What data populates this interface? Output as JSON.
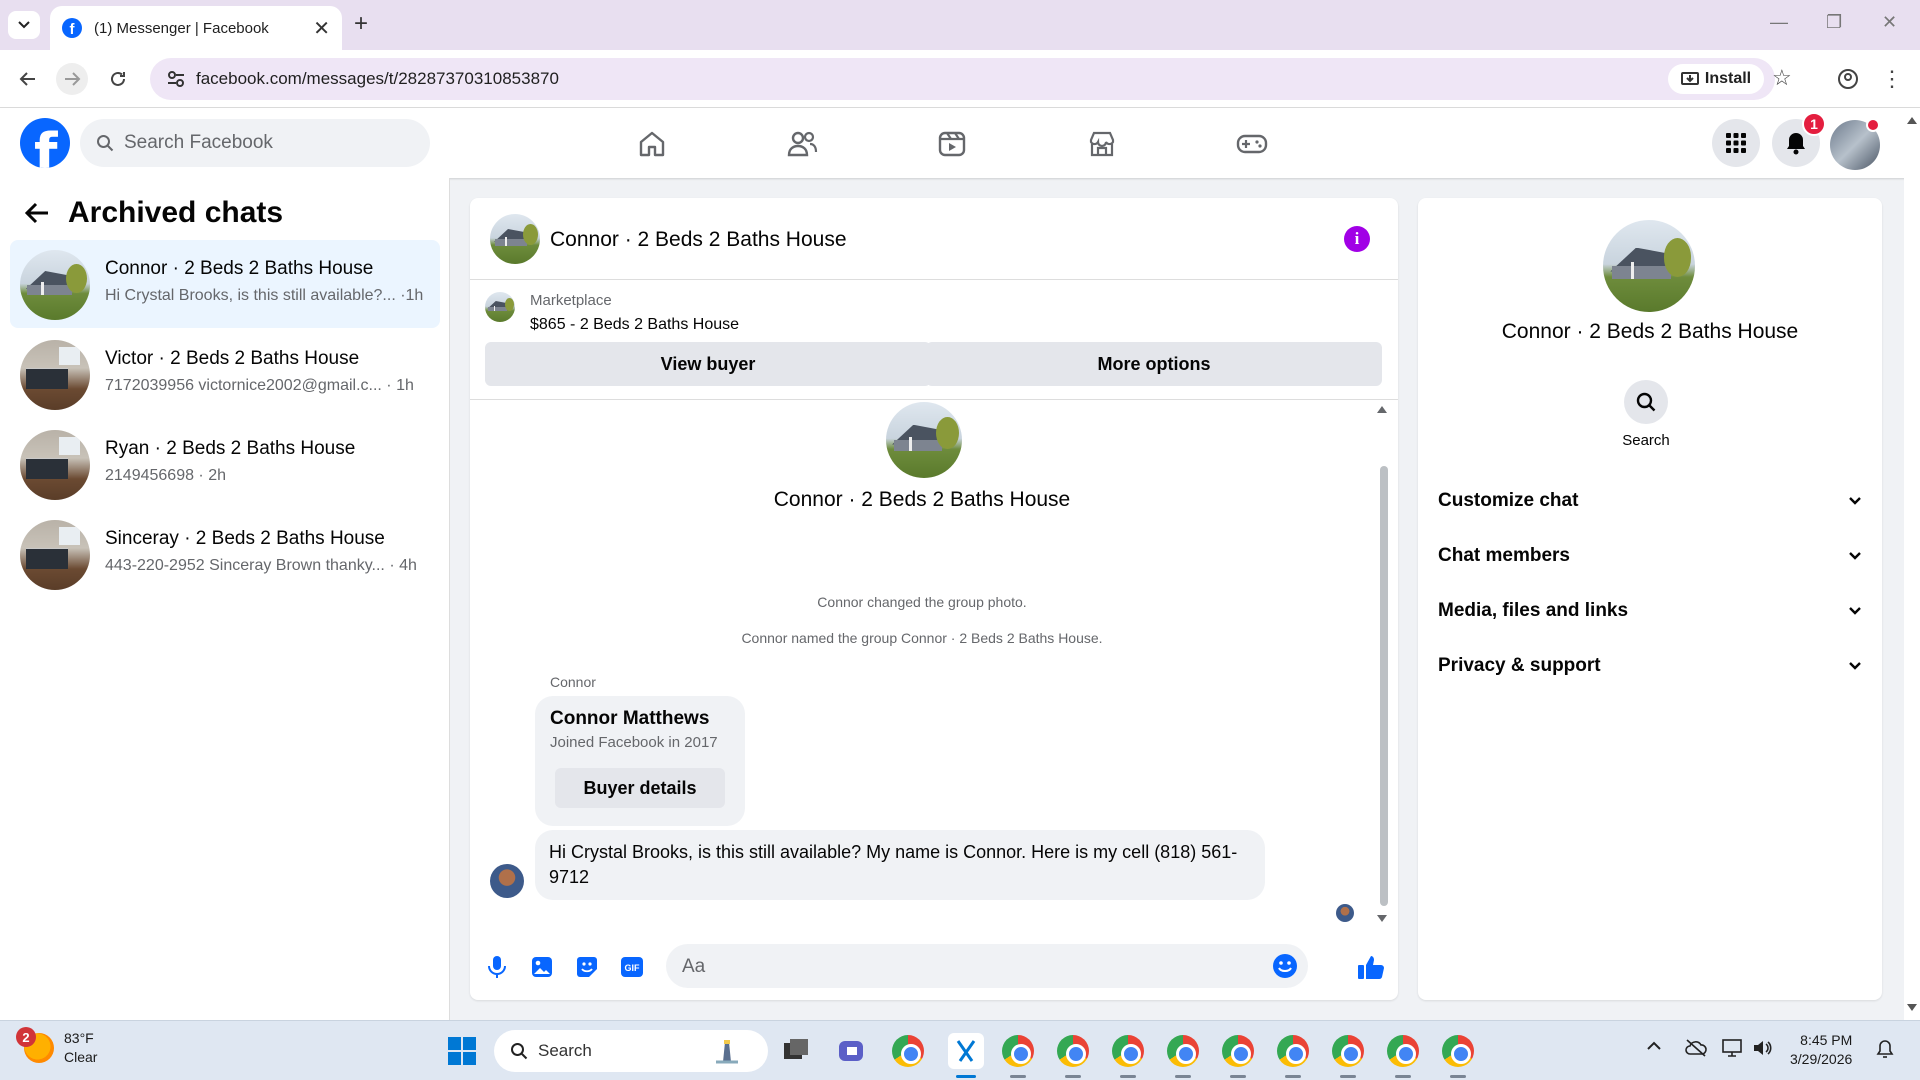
{
  "browser": {
    "tab_title": "(1) Messenger | Facebook",
    "url": "facebook.com/messages/t/28287370310853870",
    "install_label": "Install"
  },
  "fb_header": {
    "search_placeholder": "Search Facebook",
    "notification_count": "1",
    "nav_icons": [
      "home-icon",
      "friends-icon",
      "video-icon",
      "marketplace-icon",
      "gaming-icon"
    ]
  },
  "left_pane": {
    "title": "Archived chats",
    "chats": [
      {
        "name": "Connor · 2 Beds 2 Baths House",
        "snippet": "Hi Crystal Brooks, is this still available?... ·1h"
      },
      {
        "name": "Victor · 2 Beds 2 Baths House",
        "snippet": "7172039956 victornice2002@gmail.c... · 1h"
      },
      {
        "name": "Ryan · 2 Beds 2 Baths House",
        "snippet": "2149456698 · 2h"
      },
      {
        "name": "Sinceray · 2 Beds 2 Baths House",
        "snippet": "443-220-2952 Sinceray Brown thanky... · 4h"
      }
    ]
  },
  "chat": {
    "header_name": "Connor · 2 Beds 2 Baths House",
    "marketplace_label": "Marketplace",
    "listing": "$865 - 2 Beds 2 Baths House",
    "view_buyer": "View buyer",
    "more_options": "More options",
    "convo_name": "Connor · 2 Beds 2 Baths House",
    "system_messages": [
      "Connor changed the group photo.",
      "Connor named the group Connor · 2 Beds 2 Baths House."
    ],
    "sender_label": "Connor",
    "card": {
      "name": "Connor Matthews",
      "joined": "Joined Facebook in 2017",
      "button": "Buyer details"
    },
    "message": "Hi Crystal Brooks, is this still available? My name is Connor. Here is my cell (818) 561-9712",
    "composer_placeholder": "Aa"
  },
  "right_pane": {
    "name": "Connor · 2 Beds 2 Baths House",
    "search_label": "Search",
    "sections": [
      "Customize chat",
      "Chat members",
      "Media, files and links",
      "Privacy & support"
    ]
  },
  "taskbar": {
    "weather_badge": "2",
    "temperature": "83°F",
    "condition": "Clear",
    "search_placeholder": "Search",
    "time": "8:45 PM",
    "date": "3/29/2026"
  },
  "colors": {
    "fb_blue": "#0866ff",
    "active_chat_bg": "#ebf5ff",
    "info_purple": "#a100e6",
    "badge_red": "#e41e3f"
  }
}
